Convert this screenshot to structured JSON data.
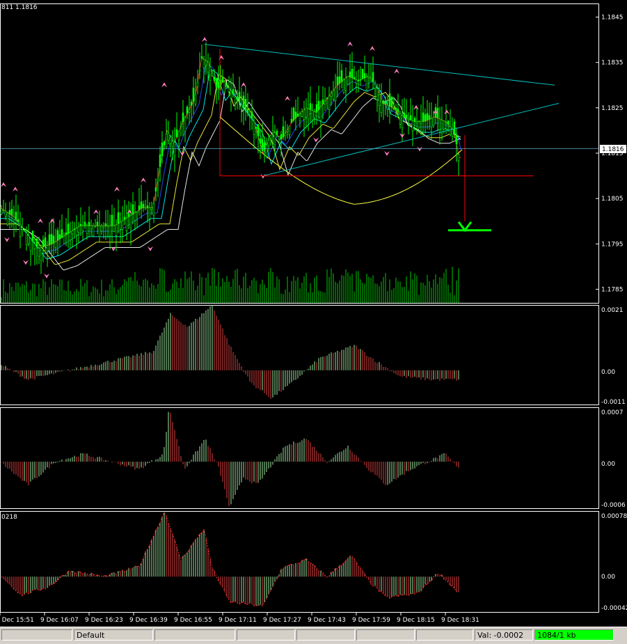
{
  "header": {
    "quote": "811 1.1816"
  },
  "colors": {
    "bull": "#00ff00",
    "bear": "#ff0000",
    "volume": "#00cc00",
    "frame": "#ffffff",
    "trendline": "#00bfbf",
    "fractal": "#ff80c0",
    "arrow": "#00ff00"
  },
  "main_axis": {
    "ticks": [
      "1.1845",
      "1.1835",
      "1.1825",
      "1.1815",
      "1.1805",
      "1.1795",
      "1.1785"
    ],
    "current_price": "1.1816"
  },
  "panels": [
    {
      "tick_top": "0.0021",
      "tick_zero": "0.00",
      "tick_bottom": "-0.0011",
      "label": ""
    },
    {
      "tick_top": "0.0007",
      "tick_zero": "0.00",
      "tick_bottom": "-0.0006",
      "label": ""
    },
    {
      "tick_top": "0.00078",
      "tick_zero": "0.00",
      "tick_bottom": "-0.00042",
      "label": "0218"
    }
  ],
  "time_labels": [
    "9 Dec 15:51",
    "9 Dec 16:07",
    "9 Dec 16:23",
    "9 Dec 16:39",
    "9 Dec 16:55",
    "9 Dec 17:11",
    "9 Dec 17:27",
    "9 Dec 17:43",
    "9 Dec 17:59",
    "9 Dec 18:15",
    "9 Dec 18:31"
  ],
  "statusbar": {
    "profile": "Default",
    "value": "Val: -0.0002",
    "traffic": "1084/1 kb"
  },
  "chart_data": [
    {
      "type": "candlestick",
      "title": "",
      "ylim": [
        1.1782,
        1.1848
      ],
      "price_path": [
        [
          0,
          1.1803
        ],
        [
          20,
          1.1801
        ],
        [
          35,
          1.1798
        ],
        [
          55,
          1.1794
        ],
        [
          75,
          1.1795
        ],
        [
          95,
          1.1797
        ],
        [
          115,
          1.1799
        ],
        [
          135,
          1.1799
        ],
        [
          165,
          1.1799
        ],
        [
          185,
          1.1801
        ],
        [
          205,
          1.1803
        ],
        [
          220,
          1.1803
        ],
        [
          230,
          1.1812
        ],
        [
          240,
          1.182
        ],
        [
          250,
          1.1817
        ],
        [
          260,
          1.1821
        ],
        [
          270,
          1.1824
        ],
        [
          280,
          1.1827
        ],
        [
          290,
          1.1836
        ],
        [
          300,
          1.1835
        ],
        [
          312,
          1.1829
        ],
        [
          322,
          1.1831
        ],
        [
          335,
          1.1828
        ],
        [
          350,
          1.1825
        ],
        [
          365,
          1.1822
        ],
        [
          378,
          1.1815
        ],
        [
          392,
          1.182
        ],
        [
          405,
          1.1818
        ],
        [
          420,
          1.1822
        ],
        [
          440,
          1.1825
        ],
        [
          455,
          1.1824
        ],
        [
          470,
          1.1827
        ],
        [
          485,
          1.183
        ],
        [
          500,
          1.1832
        ],
        [
          515,
          1.1831
        ],
        [
          530,
          1.1832
        ],
        [
          540,
          1.183
        ],
        [
          550,
          1.1826
        ],
        [
          565,
          1.1825
        ],
        [
          580,
          1.1823
        ],
        [
          595,
          1.1822
        ],
        [
          610,
          1.1822
        ],
        [
          625,
          1.1823
        ],
        [
          640,
          1.1822
        ],
        [
          652,
          1.182
        ],
        [
          660,
          1.1814
        ]
      ],
      "fractals_up": [
        [
          5,
          1.1808
        ],
        [
          22,
          1.1807
        ],
        [
          58,
          1.18
        ],
        [
          75,
          1.18
        ],
        [
          138,
          1.1802
        ],
        [
          168,
          1.1807
        ],
        [
          186,
          1.1802
        ],
        [
          206,
          1.1809
        ],
        [
          236,
          1.183
        ],
        [
          294,
          1.184
        ],
        [
          318,
          1.1836
        ],
        [
          350,
          1.183
        ],
        [
          413,
          1.1827
        ],
        [
          503,
          1.1839
        ],
        [
          535,
          1.1838
        ],
        [
          570,
          1.1833
        ],
        [
          598,
          1.1825
        ],
        [
          626,
          1.1824
        ],
        [
          642,
          1.1824
        ]
      ],
      "fractals_down": [
        [
          10,
          1.1796
        ],
        [
          37,
          1.1791
        ],
        [
          67,
          1.1788
        ],
        [
          163,
          1.1794
        ],
        [
          216,
          1.1794
        ],
        [
          262,
          1.1815
        ],
        [
          378,
          1.181
        ],
        [
          454,
          1.1818
        ],
        [
          556,
          1.1815
        ],
        [
          578,
          1.1819
        ],
        [
          603,
          1.1816
        ]
      ],
      "trendlines": [
        {
          "from": [
            294,
            1.1839
          ],
          "to": [
            797,
            1.183
          ]
        },
        {
          "from": [
            378,
            1.181
          ],
          "to": [
            803,
            1.1826
          ]
        }
      ],
      "projection": {
        "top": [
          316,
          1.1838
        ],
        "base": [
          316,
          1.181
        ],
        "base_end": [
          767,
          1.181
        ],
        "drop_from": [
          668,
          1.1819
        ],
        "drop_to": [
          668,
          1.18
        ],
        "target": [
          [
            644,
            1.1798
          ],
          [
            706,
            1.1798
          ]
        ]
      }
    },
    {
      "type": "histogram",
      "name": "",
      "ylim": [
        -0.0011,
        0.0021
      ],
      "peaks": [
        [
          0,
          0.0002
        ],
        [
          40,
          -0.0003
        ],
        [
          100,
          0.0
        ],
        [
          160,
          0.0003
        ],
        [
          220,
          0.0006
        ],
        [
          245,
          0.0018
        ],
        [
          270,
          0.0014
        ],
        [
          305,
          0.0021
        ],
        [
          330,
          0.0008
        ],
        [
          360,
          -0.0004
        ],
        [
          390,
          -0.0009
        ],
        [
          420,
          -0.0004
        ],
        [
          460,
          0.0004
        ],
        [
          510,
          0.0008
        ],
        [
          540,
          0.0003
        ],
        [
          575,
          -0.0002
        ],
        [
          620,
          -0.0003
        ],
        [
          660,
          -0.0003
        ]
      ]
    },
    {
      "type": "histogram",
      "name": "",
      "ylim": [
        -0.0006,
        0.0007
      ],
      "peaks": [
        [
          0,
          0.0
        ],
        [
          40,
          -0.0003
        ],
        [
          80,
          0.0
        ],
        [
          120,
          0.0001
        ],
        [
          160,
          0.0
        ],
        [
          200,
          -0.0001
        ],
        [
          235,
          0.0001
        ],
        [
          243,
          0.0007
        ],
        [
          265,
          -0.0001
        ],
        [
          295,
          0.0003
        ],
        [
          315,
          -0.0001
        ],
        [
          330,
          -0.0006
        ],
        [
          350,
          -0.0002
        ],
        [
          370,
          -0.0003
        ],
        [
          410,
          0.0002
        ],
        [
          440,
          0.0003
        ],
        [
          470,
          0.0
        ],
        [
          500,
          0.0002
        ],
        [
          530,
          -0.0001
        ],
        [
          555,
          -0.0003
        ],
        [
          590,
          -0.0001
        ],
        [
          640,
          0.0001
        ],
        [
          660,
          -0.0001
        ]
      ]
    },
    {
      "type": "histogram",
      "name": "",
      "ylim": [
        -0.00042,
        0.00078
      ],
      "peaks": [
        [
          0,
          3e-05
        ],
        [
          30,
          -0.00022
        ],
        [
          70,
          -0.00012
        ],
        [
          100,
          7e-05
        ],
        [
          150,
          0.0
        ],
        [
          200,
          0.00012
        ],
        [
          237,
          0.00078
        ],
        [
          260,
          0.0002
        ],
        [
          293,
          0.00057
        ],
        [
          305,
          0.0001
        ],
        [
          330,
          -0.0003
        ],
        [
          378,
          -0.00035
        ],
        [
          405,
          0.0001
        ],
        [
          440,
          0.0002
        ],
        [
          470,
          0.0
        ],
        [
          505,
          0.00025
        ],
        [
          530,
          -5e-05
        ],
        [
          555,
          -0.00025
        ],
        [
          600,
          -0.0002
        ],
        [
          630,
          5e-05
        ],
        [
          660,
          -0.0002
        ]
      ]
    }
  ]
}
